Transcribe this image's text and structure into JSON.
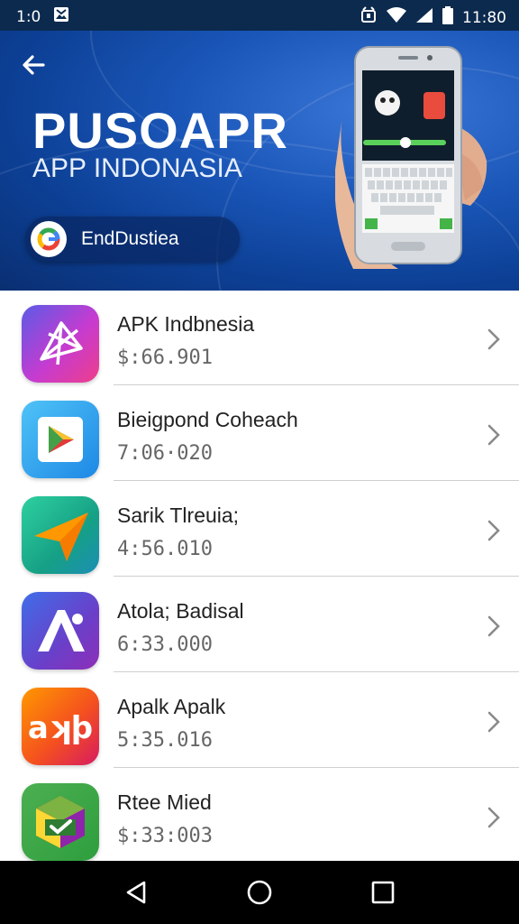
{
  "status_bar": {
    "left_time": "1:0",
    "right_time": "11:80"
  },
  "header": {
    "title": "PUSOAPR",
    "subtitle": "APP INDONASIA",
    "chip_label": "EndDustiea",
    "back_icon": "arrow-left-icon",
    "colors": {
      "bg": "#1a56b8",
      "chip": "#0a2864"
    }
  },
  "apps": [
    {
      "name": "APK Indbnesia",
      "value": "$:66.901",
      "icon": "polygon-star-icon",
      "color": "#a03fd0"
    },
    {
      "name": "Bieigpond Coheach",
      "value": "7:06·020",
      "icon": "play-store-icon",
      "color": "#1e9be9"
    },
    {
      "name": "Sarik Tlreuia;",
      "value": "4:56.010",
      "icon": "paper-plane-icon",
      "color": "#21b58f"
    },
    {
      "name": "Atola; Badisal",
      "value": "6:33.000",
      "icon": "letter-a-icon",
      "color": "#5b49c9"
    },
    {
      "name": "Apalk Apalk",
      "value": "5:35.016",
      "icon": "apk-text-icon",
      "color": "#f15a24"
    },
    {
      "name": "Rtee Mied",
      "value": "$:33:003",
      "icon": "checkmark-cube-icon",
      "color": "#3fb34f"
    }
  ],
  "apk_icon_text": "aʞþ",
  "nav": {
    "back": "back-triangle-icon",
    "home": "home-circle-icon",
    "recents": "recents-square-icon"
  }
}
